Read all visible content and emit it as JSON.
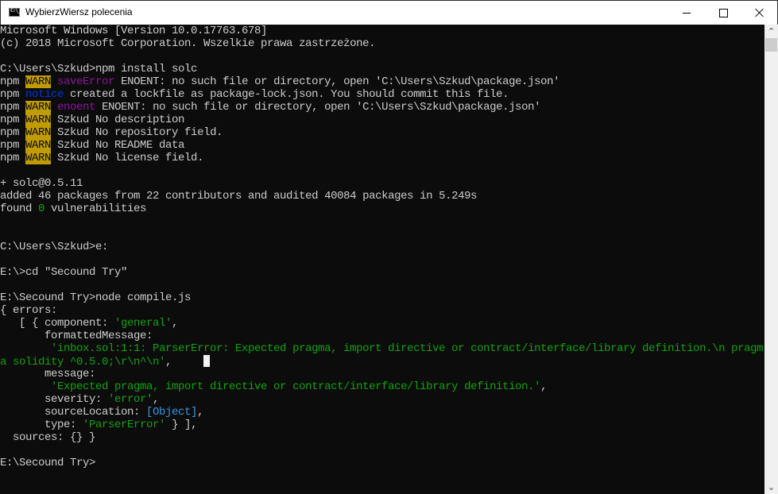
{
  "window": {
    "title": "WybierzWiersz polecenia",
    "icon": "console-icon",
    "controls": {
      "minimize": "minimize-icon",
      "maximize": "maximize-icon",
      "close": "close-icon"
    }
  },
  "colors": {
    "background": "#0c0c0c",
    "text": "#cccccc",
    "warn_bg": "#c19c00",
    "magenta": "#881798",
    "blue": "#0037da",
    "green": "#13a10e",
    "cyan": "#3a96dd"
  },
  "console": {
    "lines": [
      [
        {
          "t": "Microsoft Windows [Version 10.0.17763.678]"
        }
      ],
      [
        {
          "t": "(c) 2018 Microsoft Corporation. Wszelkie prawa zastrzeżone."
        }
      ],
      [],
      [
        {
          "t": "C:\\Users\\Szkud>npm install solc"
        }
      ],
      [
        {
          "t": "npm "
        },
        {
          "t": "WARN",
          "c": "warn"
        },
        {
          "t": " "
        },
        {
          "t": "saveError",
          "c": "magenta"
        },
        {
          "t": " ENOENT: no such file or directory, open 'C:\\Users\\Szkud\\package.json'"
        }
      ],
      [
        {
          "t": "npm "
        },
        {
          "t": "notice",
          "c": "blue"
        },
        {
          "t": " created a lockfile as package-lock.json. You should commit this file."
        }
      ],
      [
        {
          "t": "npm "
        },
        {
          "t": "WARN",
          "c": "warn"
        },
        {
          "t": " "
        },
        {
          "t": "enoent",
          "c": "magenta"
        },
        {
          "t": " ENOENT: no such file or directory, open 'C:\\Users\\Szkud\\package.json'"
        }
      ],
      [
        {
          "t": "npm "
        },
        {
          "t": "WARN",
          "c": "warn"
        },
        {
          "t": " Szkud No description"
        }
      ],
      [
        {
          "t": "npm "
        },
        {
          "t": "WARN",
          "c": "warn"
        },
        {
          "t": " Szkud No repository field."
        }
      ],
      [
        {
          "t": "npm "
        },
        {
          "t": "WARN",
          "c": "warn"
        },
        {
          "t": " Szkud No README data"
        }
      ],
      [
        {
          "t": "npm "
        },
        {
          "t": "WARN",
          "c": "warn"
        },
        {
          "t": " Szkud No license field."
        }
      ],
      [],
      [
        {
          "t": "+ solc@0.5.11"
        }
      ],
      [
        {
          "t": "added 46 packages from 22 contributors and audited 40084 packages in 5.249s"
        }
      ],
      [
        {
          "t": "found "
        },
        {
          "t": "0",
          "c": "green"
        },
        {
          "t": " vulnerabilities"
        }
      ],
      [],
      [],
      [
        {
          "t": "C:\\Users\\Szkud>e:"
        }
      ],
      [],
      [
        {
          "t": "E:\\>cd \"Secound Try\""
        }
      ],
      [],
      [
        {
          "t": "E:\\Secound Try>node compile.js"
        }
      ],
      [
        {
          "t": "{ errors:"
        }
      ],
      [
        {
          "t": "   [ { component: "
        },
        {
          "t": "'general'",
          "c": "green"
        },
        {
          "t": ","
        }
      ],
      [
        {
          "t": "       formattedMessage:"
        }
      ],
      [
        {
          "t": "        'inbox.sol:1:1: ParserError: Expected pragma, import directive or contract/interface/library definition.\\n pragm",
          "c": "green"
        }
      ],
      [
        {
          "t": "a solidity ^0.5.0;\\r\\n^\\n'",
          "c": "green"
        },
        {
          "t": ",     "
        },
        {
          "cursor": true
        }
      ],
      [
        {
          "t": "       message:"
        }
      ],
      [
        {
          "t": "        'Expected pragma, import directive or contract/interface/library definition.'",
          "c": "green"
        },
        {
          "t": ","
        }
      ],
      [
        {
          "t": "       severity: "
        },
        {
          "t": "'error'",
          "c": "green"
        },
        {
          "t": ","
        }
      ],
      [
        {
          "t": "       sourceLocation: "
        },
        {
          "t": "[Object]",
          "c": "cyan"
        },
        {
          "t": ","
        }
      ],
      [
        {
          "t": "       type: "
        },
        {
          "t": "'ParserError'",
          "c": "green"
        },
        {
          "t": " } ],"
        }
      ],
      [
        {
          "t": "  sources: {} }"
        }
      ],
      [],
      [
        {
          "t": "E:\\Secound Try>"
        }
      ]
    ]
  },
  "scrollbar": {
    "up_icon": "chevron-up-icon",
    "down_icon": "chevron-down-icon",
    "position": 0.0
  }
}
